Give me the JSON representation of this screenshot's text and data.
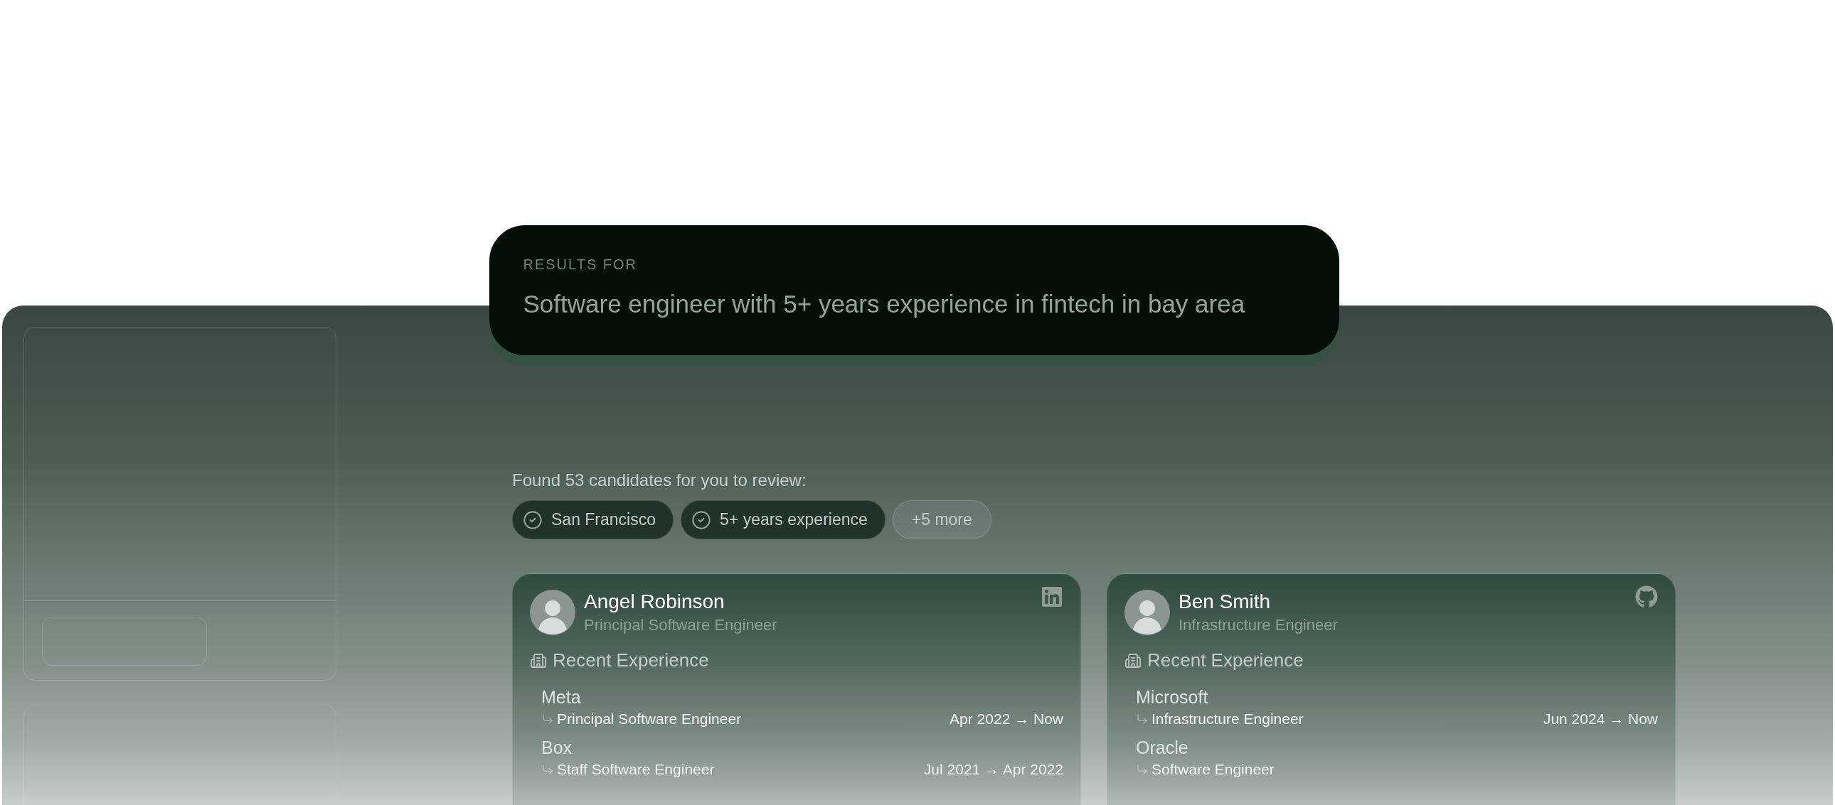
{
  "search": {
    "label": "RESULTS FOR",
    "query": "Software engineer with 5+ years experience in fintech in bay area"
  },
  "results": {
    "summary": "Found 53 candidates for you to review:",
    "filters": [
      {
        "kind": "applied",
        "label": "San Francisco"
      },
      {
        "kind": "applied",
        "label": "5+ years experience"
      },
      {
        "kind": "more",
        "label": "+5 more"
      }
    ]
  },
  "candidates": [
    {
      "name": "Angel Robinson",
      "title": "Principal Software Engineer",
      "profile": {
        "kind": "linkedin"
      },
      "section": "Recent Experience",
      "experience": [
        {
          "company": "Meta",
          "role": "Principal Software Engineer",
          "dates": "Apr 2022 → Now"
        },
        {
          "company": "Box",
          "role": "Staff Software Engineer",
          "dates": "Jul 2021 → Apr 2022"
        }
      ]
    },
    {
      "name": "Ben Smith",
      "title": "Infrastructure Engineer",
      "profile": {
        "kind": "github"
      },
      "section": "Recent Experience",
      "experience": [
        {
          "company": "Microsoft",
          "role": "Infrastructure Engineer",
          "dates": "Jun 2024 → Now"
        },
        {
          "company": "Oracle",
          "role": "Software Engineer"
        }
      ]
    }
  ]
}
